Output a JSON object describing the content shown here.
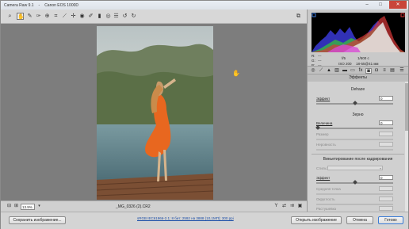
{
  "title_bar": {
    "app": "Camera Raw 9.1",
    "separator": "-",
    "camera": "Canon EOS 1000D"
  },
  "window_buttons": {
    "minimize": "–",
    "maximize": "□",
    "close": "✕"
  },
  "toolbar": {
    "tools": [
      "zoom-icon",
      "hand-icon",
      "white-balance-icon",
      "color-sampler-icon",
      "target-adjust-icon",
      "crop-icon",
      "straighten-icon",
      "spot-removal-icon",
      "red-eye-icon",
      "adjustment-brush-icon",
      "graduated-filter-icon",
      "radial-filter-icon",
      "preferences-icon",
      "rotate-ccw-icon",
      "rotate-cw-icon"
    ],
    "fullscreen": "fullscreen-icon"
  },
  "status": {
    "zoom": "13.9%",
    "filename": "_MG_0326 (2).CR2"
  },
  "readout": {
    "r": "R:",
    "g": "G:",
    "b": "B:",
    "r_val": "---",
    "g_val": "---",
    "b_val": "---",
    "aperture": "f/5",
    "shutter": "1/500 c",
    "iso": "ISO 200",
    "lens": "18-55@41 мм"
  },
  "panel": {
    "title": "Эффекты",
    "dehaze": {
      "section": "Dehaze",
      "label": "Эффект",
      "value": "0"
    },
    "grain": {
      "section": "Зерно",
      "amount_label": "Величина",
      "amount_value": "0",
      "size_label": "Размер",
      "size_value": "",
      "roughness_label": "Неровность",
      "roughness_value": ""
    },
    "vignette": {
      "section": "Виньетирование после кадрирования",
      "style_label": "Стиль:",
      "style_value": "",
      "amount_label": "Эффект",
      "amount_value": "0",
      "midpoint_label": "Средняя точка",
      "midpoint_value": "",
      "roundness_label": "Округлость",
      "roundness_value": "",
      "feather_label": "Растушевка",
      "feather_value": ""
    }
  },
  "bottom": {
    "save_label": "Сохранить изображение...",
    "workflow_link": "sRGB IEC61966-2.1; 8 бит; 2592 на 3888 (10,1МП); 300 ppi",
    "open_label": "Открыть изображение",
    "cancel_label": "Отмена",
    "done_label": "Готово"
  }
}
